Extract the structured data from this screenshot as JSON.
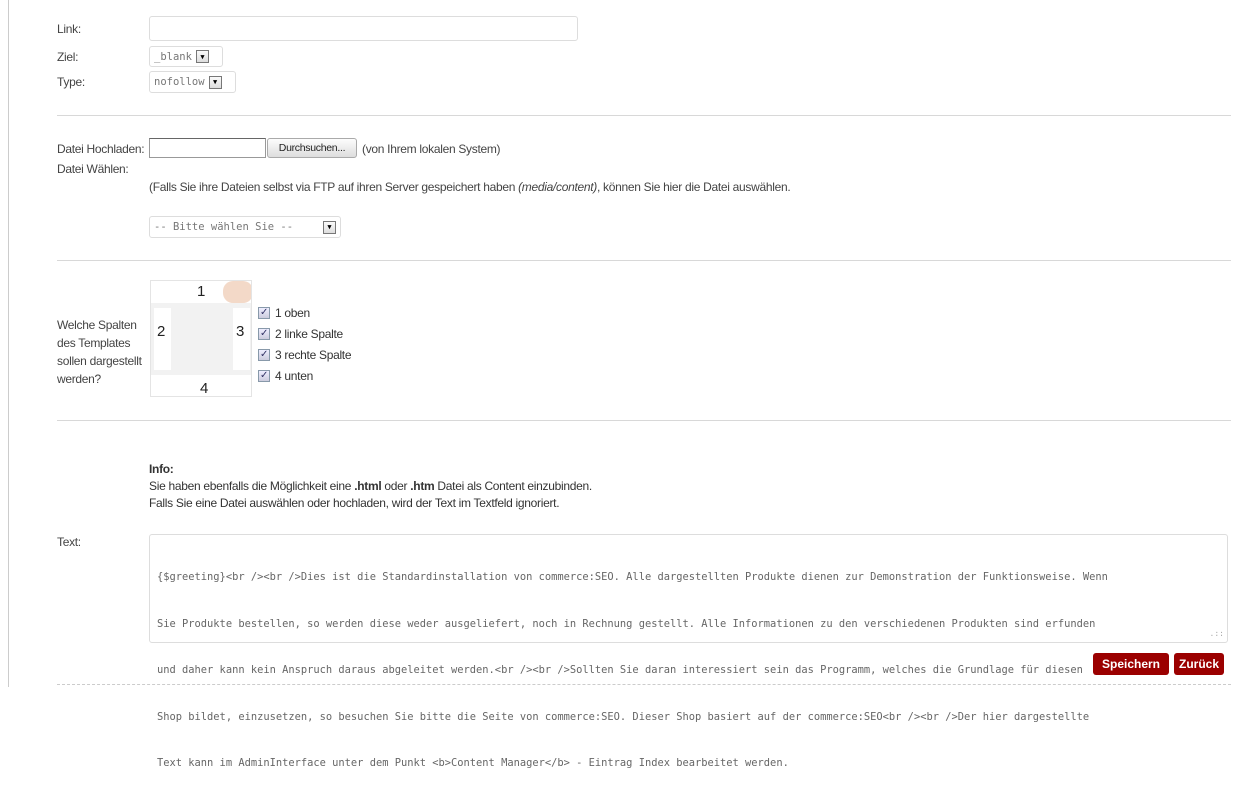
{
  "link": {
    "label": "Link:",
    "value": ""
  },
  "ziel": {
    "label": "Ziel:",
    "value": "_blank"
  },
  "type": {
    "label": "Type:",
    "value": "nofollow"
  },
  "upload": {
    "label": "Datei Hochladen:",
    "browse_label": "Durchsuchen...",
    "hint": "(von Ihrem lokalen System)"
  },
  "choose": {
    "label": "Datei Wählen:",
    "hint_pre": "(Falls Sie ihre Dateien selbst via FTP auf ihren Server gespeichert haben ",
    "hint_path": "(media/content)",
    "hint_post": ", können Sie hier die Datei auswählen.",
    "select_value": "-- Bitte wählen Sie --"
  },
  "columns": {
    "label": "Welche Spalten des Templates sollen dargestellt werden?",
    "thumb_numbers": [
      "1",
      "2",
      "3",
      "4"
    ],
    "options": [
      {
        "label": "1 oben",
        "checked": true
      },
      {
        "label": "2 linke Spalte",
        "checked": true
      },
      {
        "label": "3 rechte Spalte",
        "checked": true
      },
      {
        "label": "4 unten",
        "checked": true
      }
    ]
  },
  "info": {
    "title": "Info:",
    "line1_a": "Sie haben ebenfalls die Möglichkeit eine ",
    "line1_b": ".html",
    "line1_c": " oder ",
    "line1_d": ".htm",
    "line1_e": " Datei als Content einzubinden.",
    "line2": "Falls Sie eine Datei auswählen oder hochladen, wird der Text im Textfeld ignoriert."
  },
  "text": {
    "label": "Text:",
    "lines": [
      "{$greeting}<br /><br />Dies ist die Standardinstallation von commerce:SEO. Alle dargestellten Produkte dienen zur Demonstration der Funktionsweise. Wenn",
      "Sie Produkte bestellen, so werden diese weder ausgeliefert, noch in Rechnung gestellt. Alle Informationen zu den verschiedenen Produkten sind erfunden",
      "und daher kann kein Anspruch daraus abgeleitet werden.<br /><br />Sollten Sie daran interessiert sein das Programm, welches die Grundlage für diesen",
      "Shop bildet, einzusetzen, so besuchen Sie bitte die Seite von commerce:SEO. Dieser Shop basiert auf der commerce:SEO<br /><br />Der hier dargestellte",
      "Text kann im AdminInterface unter dem Punkt <b>Content Manager</b> - Eintrag Index bearbeitet werden."
    ]
  },
  "buttons": {
    "save": "Speichern",
    "back": "Zurück"
  },
  "colors": {
    "button": "#9b0000"
  }
}
